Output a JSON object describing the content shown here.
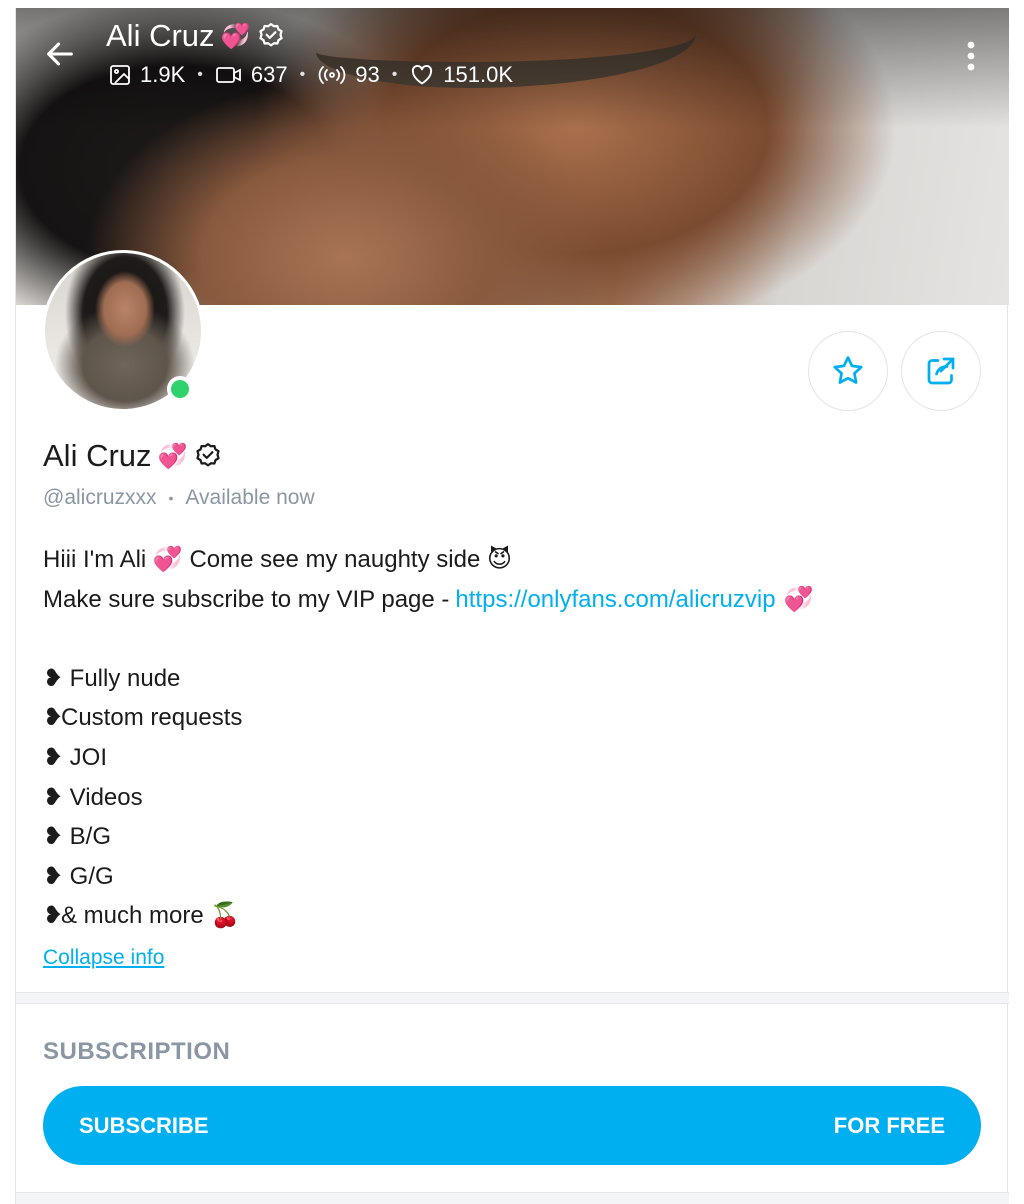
{
  "header": {
    "name": "Ali Cruz",
    "name_emoji": "💞",
    "stats": [
      {
        "icon": "image-icon",
        "value": "1.9K"
      },
      {
        "icon": "video-icon",
        "value": "637"
      },
      {
        "icon": "broadcast-icon",
        "value": "93"
      },
      {
        "icon": "heart-icon",
        "value": "151.0K"
      }
    ],
    "separator": "•"
  },
  "profile": {
    "name": "Ali Cruz",
    "name_emoji": "💞",
    "handle": "@alicruzxxx",
    "separator": "•",
    "status": "Available now",
    "online_color": "#2fd36b"
  },
  "bio": {
    "line1_text": "Hiii I'm Ali 💞 Come see my naughty side 😈",
    "line2_text": "Make sure subscribe to my VIP page -",
    "line2_link": "https://onlyfans.com/alicruzvip",
    "line2_emoji": "💞",
    "bullet": "❥",
    "items": [
      " Fully nude",
      "Custom requests",
      " JOI",
      " Videos",
      " B/G",
      " G/G",
      "& much more 🍒"
    ]
  },
  "collapse_label": "Collapse info",
  "subscription": {
    "title": "SUBSCRIPTION",
    "button_left": "SUBSCRIBE",
    "button_right": "FOR FREE",
    "accent": "#00aff0"
  }
}
